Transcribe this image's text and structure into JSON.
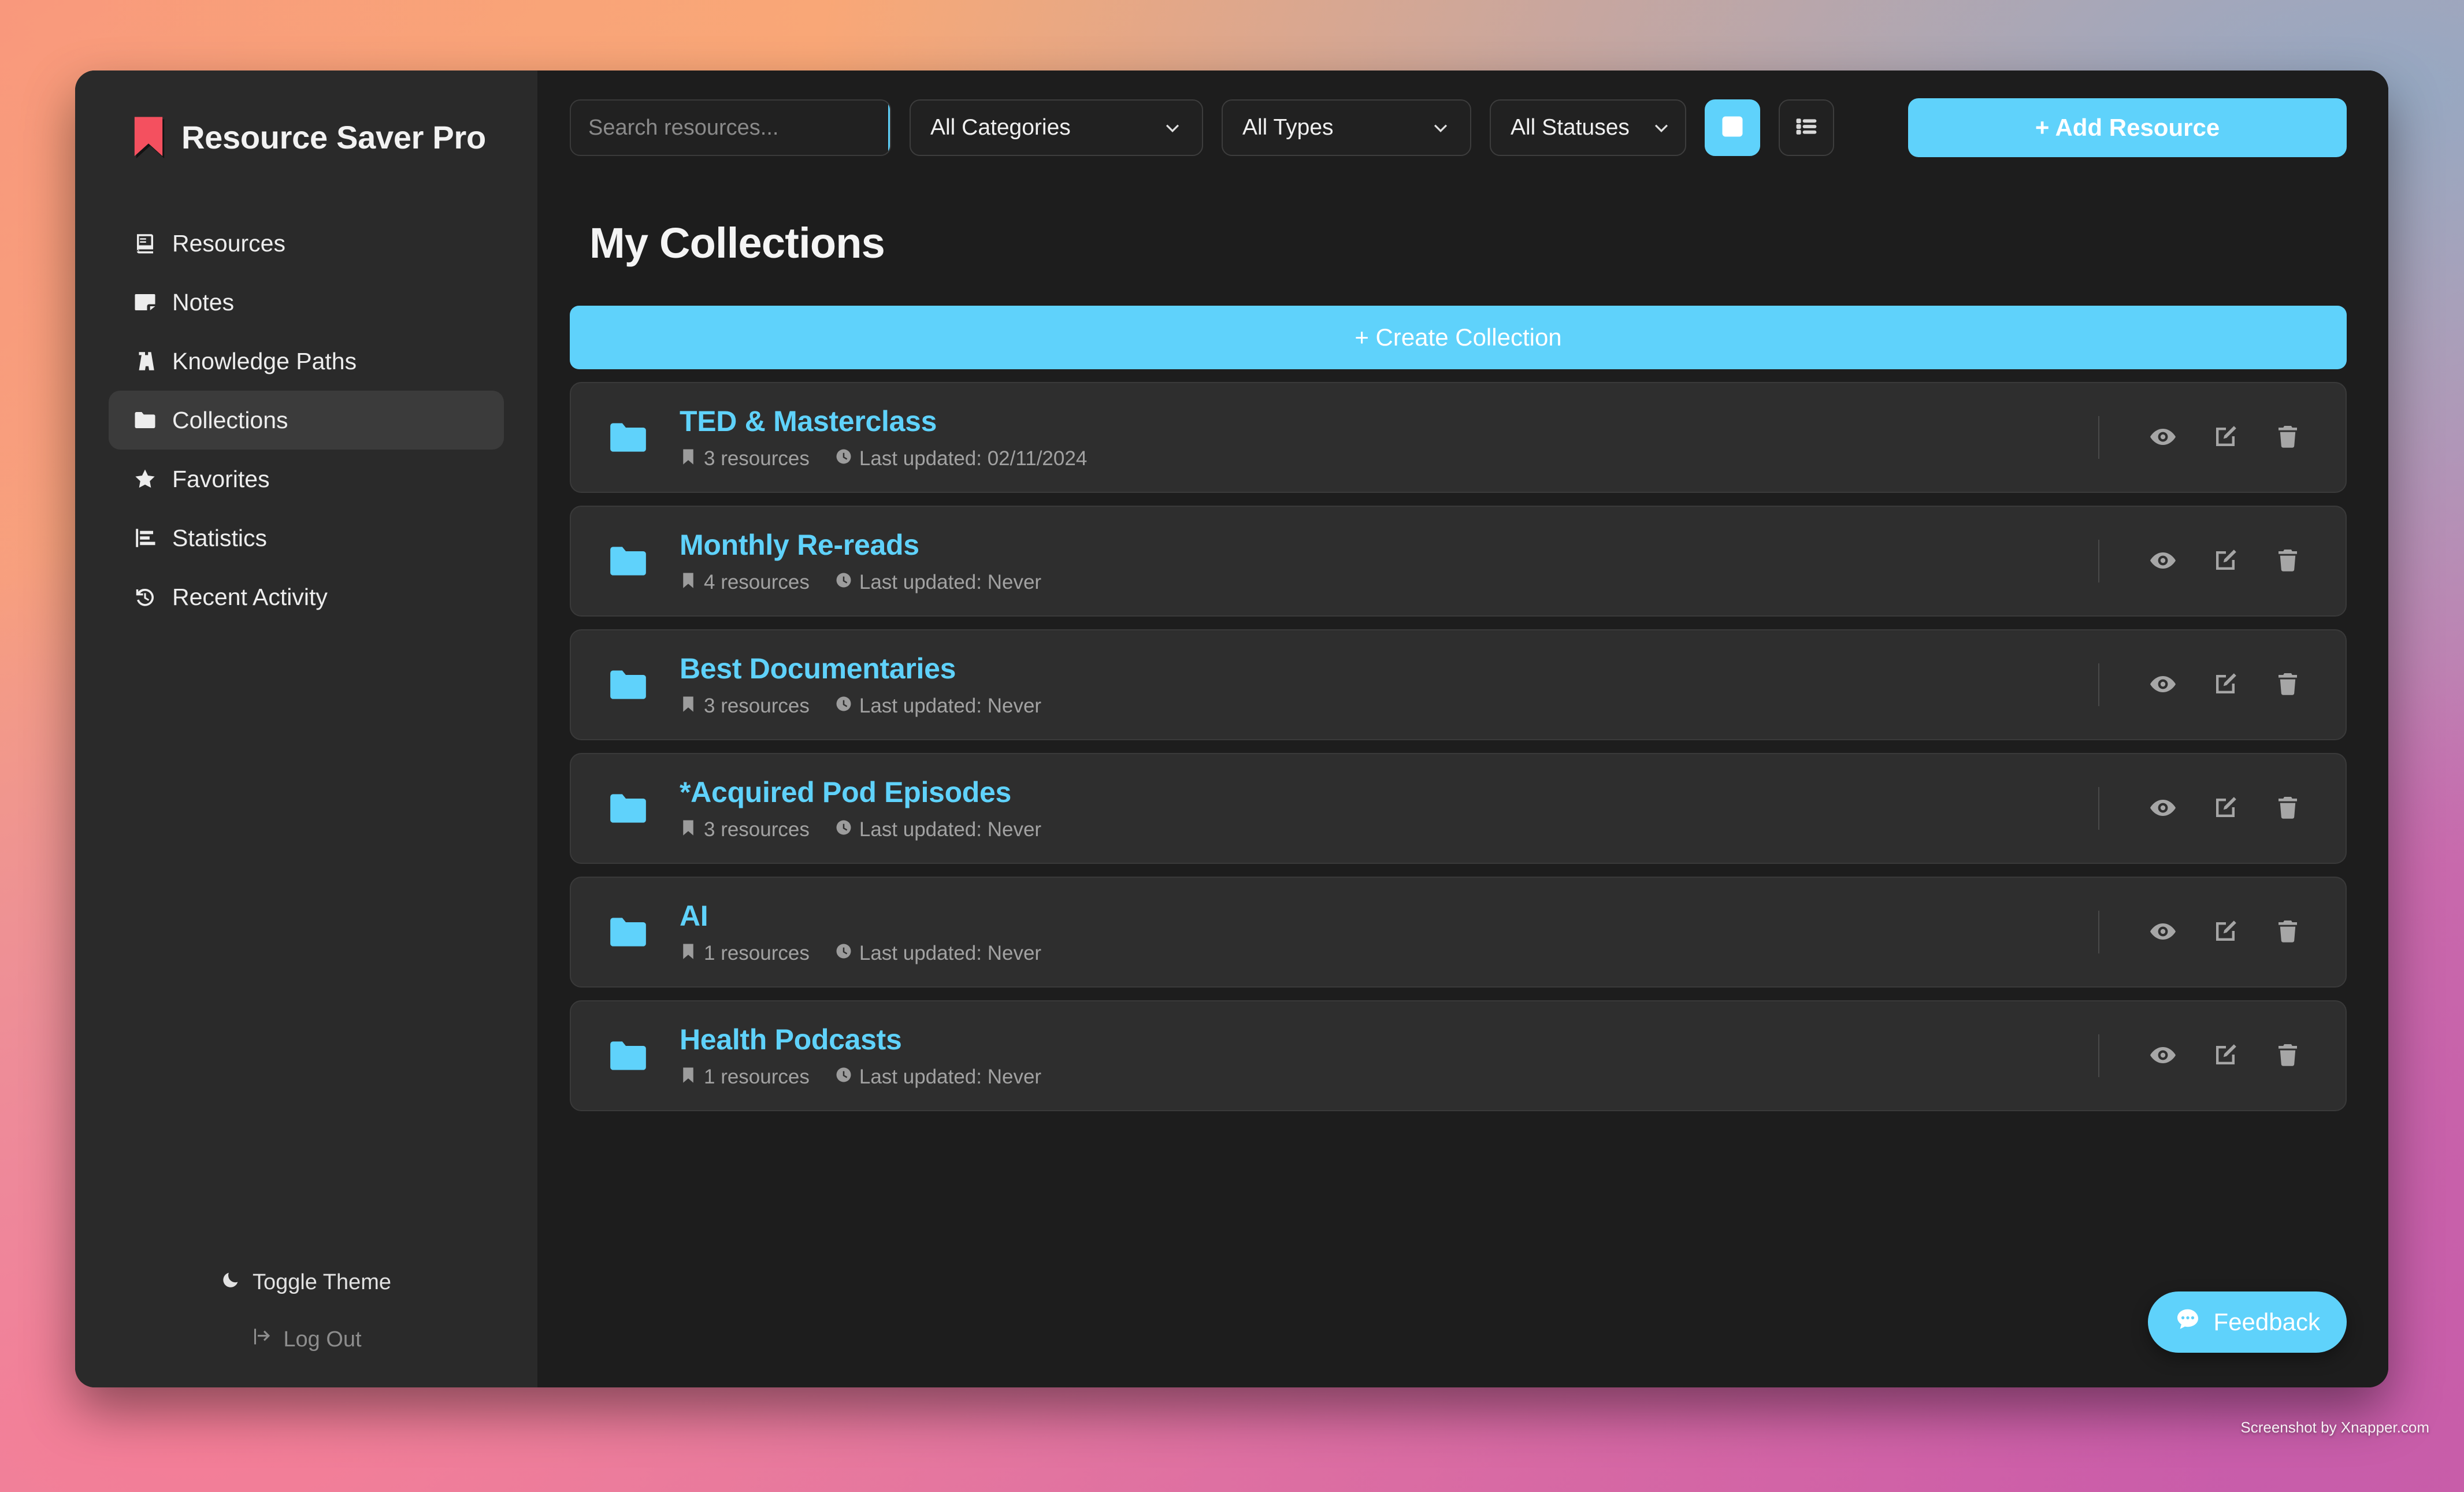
{
  "app": {
    "name": "Resource Saver Pro",
    "logo_icon": "bookmark-icon",
    "logo_color": "#f4505f",
    "accent_color": "#5fd2fb",
    "window_bg": "#1d1d1d",
    "sidebar_bg": "#2a2a2a"
  },
  "sidebar": {
    "items": [
      {
        "label": "Resources",
        "icon": "book-icon",
        "active": false
      },
      {
        "label": "Notes",
        "icon": "note-icon",
        "active": false
      },
      {
        "label": "Knowledge Paths",
        "icon": "road-icon",
        "active": false
      },
      {
        "label": "Collections",
        "icon": "folder-icon",
        "active": true
      },
      {
        "label": "Favorites",
        "icon": "star-icon",
        "active": false
      },
      {
        "label": "Statistics",
        "icon": "bar-chart-icon",
        "active": false
      },
      {
        "label": "Recent Activity",
        "icon": "history-icon",
        "active": false
      }
    ],
    "theme_toggle": {
      "label": "Toggle Theme",
      "icon": "moon-icon"
    },
    "logout": {
      "label": "Log Out",
      "icon": "logout-icon"
    }
  },
  "toolbar": {
    "search": {
      "placeholder": "Search resources...",
      "value": "",
      "button_icon": "search-icon"
    },
    "filters": [
      {
        "name": "categories",
        "selected": "All Categories"
      },
      {
        "name": "types",
        "selected": "All Types"
      },
      {
        "name": "statuses",
        "selected": "All Statuses"
      }
    ],
    "views": [
      {
        "name": "grid",
        "icon": "grid-icon",
        "active": true
      },
      {
        "name": "list",
        "icon": "list-icon",
        "active": false
      }
    ],
    "add_resource_label": "+ Add Resource"
  },
  "main": {
    "page_title": "My Collections",
    "create_collection_label": "+ Create Collection",
    "collections": [
      {
        "name": "TED & Masterclass",
        "resources": "3 resources",
        "updated": "Last updated: 02/11/2024"
      },
      {
        "name": "Monthly Re-reads",
        "resources": "4 resources",
        "updated": "Last updated: Never"
      },
      {
        "name": "Best Documentaries",
        "resources": "3 resources",
        "updated": "Last updated: Never"
      },
      {
        "name": "*Acquired Pod Episodes",
        "resources": "3 resources",
        "updated": "Last updated: Never"
      },
      {
        "name": "AI",
        "resources": "1 resources",
        "updated": "Last updated: Never"
      },
      {
        "name": "Health Podcasts",
        "resources": "1 resources",
        "updated": "Last updated: Never"
      }
    ],
    "row_actions": [
      {
        "name": "view",
        "icon": "eye-icon"
      },
      {
        "name": "edit",
        "icon": "edit-icon"
      },
      {
        "name": "delete",
        "icon": "trash-icon"
      }
    ]
  },
  "feedback": {
    "label": "Feedback",
    "icon": "chat-bubble-icon"
  },
  "watermark": "Screenshot by Xnapper.com"
}
